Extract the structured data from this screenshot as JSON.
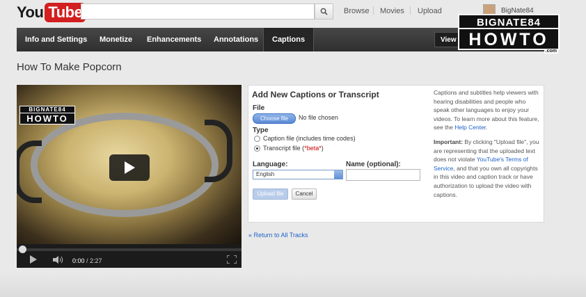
{
  "header": {
    "logo_you": "You",
    "logo_tube": "Tube",
    "search_placeholder": "",
    "nav": [
      "Browse",
      "Movies",
      "Upload"
    ],
    "username": "BigNate84"
  },
  "tabs": [
    "Info and Settings",
    "Monetize",
    "Enhancements",
    "Annotations",
    "Captions"
  ],
  "active_tab": "Captions",
  "view_button": "View on video page",
  "watermark": {
    "line1": "BIGNATE84",
    "line2": "HOWTO",
    "suffix": ".com"
  },
  "page_title": "How To Make Popcorn",
  "player": {
    "watermark_line1": "BIGNATE84",
    "watermark_line2": "HOWTO",
    "current_time": "0:00",
    "duration": "/ 2:27",
    "progress": 0
  },
  "captions": {
    "title": "Add New Captions or Transcript",
    "file_label": "File",
    "choose_file": "Choose file",
    "no_file": "No file chosen",
    "type_label": "Type",
    "caption_option": "Caption file (includes time codes)",
    "transcript_option_prefix": "Transcript file (",
    "transcript_option_beta": "*beta*",
    "transcript_option_suffix": ")",
    "selected_type": "transcript",
    "language_label": "Language:",
    "language_value": "English",
    "name_label": "Name (optional):",
    "name_value": "",
    "upload_button": "Upload file",
    "cancel_button": "Cancel",
    "help_p1": "Captions and subtitles help viewers with hearing disabilities and people who speak other languages to enjoy your videos. To learn more about this feature, see the",
    "help_link": "Help Center",
    "help_p1_end": ".",
    "help_important": "Important:",
    "help_p2a": "By clicking \"Upload file\", you are representing that the uploaded text does not violate",
    "help_tos": "YouTube's Terms of Service",
    "help_p2b": ", and that you own all copyrights in this video and caption track or have authorization to upload the video with captions."
  },
  "return_link": "« Return to All Tracks"
}
